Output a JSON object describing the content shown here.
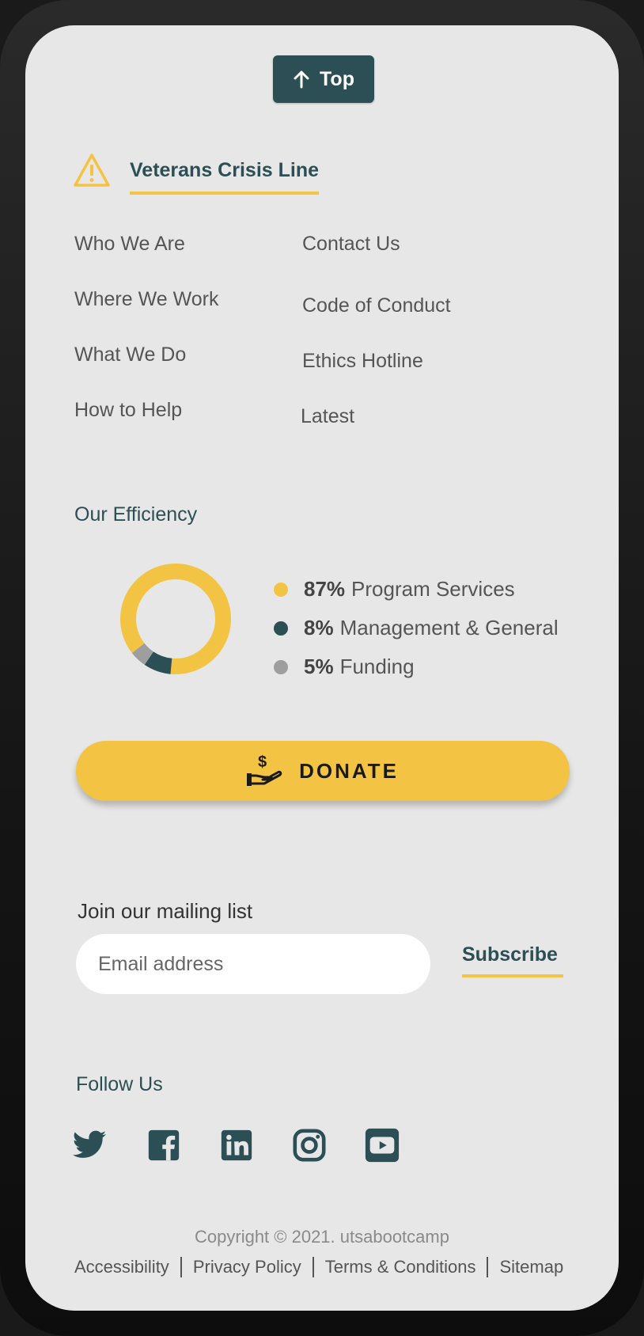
{
  "top_button": {
    "label": "Top"
  },
  "crisis": {
    "label": "Veterans Crisis Line"
  },
  "nav": {
    "left": [
      "Who We Are",
      "Where We Work",
      "What We Do",
      "How to Help"
    ],
    "right": [
      "Contact Us",
      "Code of Conduct",
      "Ethics Hotline",
      "Latest"
    ]
  },
  "efficiency": {
    "title": "Our Efficiency",
    "items": [
      {
        "pct": "87%",
        "label": "Program Services",
        "color": "#f3c444"
      },
      {
        "pct": "8%",
        "label": "Management & General",
        "color": "#2b4f55"
      },
      {
        "pct": "5%",
        "label": "Funding",
        "color": "#9e9e9e"
      }
    ]
  },
  "chart_data": {
    "type": "pie",
    "categories": [
      "Program Services",
      "Management & General",
      "Funding"
    ],
    "values": [
      87,
      8,
      5
    ],
    "colors": [
      "#f3c444",
      "#2b4f55",
      "#9e9e9e"
    ],
    "title": "Our Efficiency",
    "donut": true
  },
  "donate": {
    "label": "DONATE",
    "icon": "donate-hand-icon"
  },
  "mailing": {
    "title": "Join our mailing list",
    "email_placeholder": "Email address",
    "subscribe_label": "Subscribe"
  },
  "follow": {
    "title": "Follow Us",
    "icons": [
      "twitter-icon",
      "facebook-icon",
      "linkedin-icon",
      "instagram-icon",
      "youtube-icon"
    ]
  },
  "footer": {
    "copyright": "Copyright © 2021. utsabootcamp",
    "links": [
      "Accessibility",
      "Privacy Policy",
      "Terms & Conditions",
      "Sitemap"
    ]
  },
  "colors": {
    "accent": "#f3c444",
    "primary": "#2b4f55",
    "background": "#e7e7e7"
  }
}
